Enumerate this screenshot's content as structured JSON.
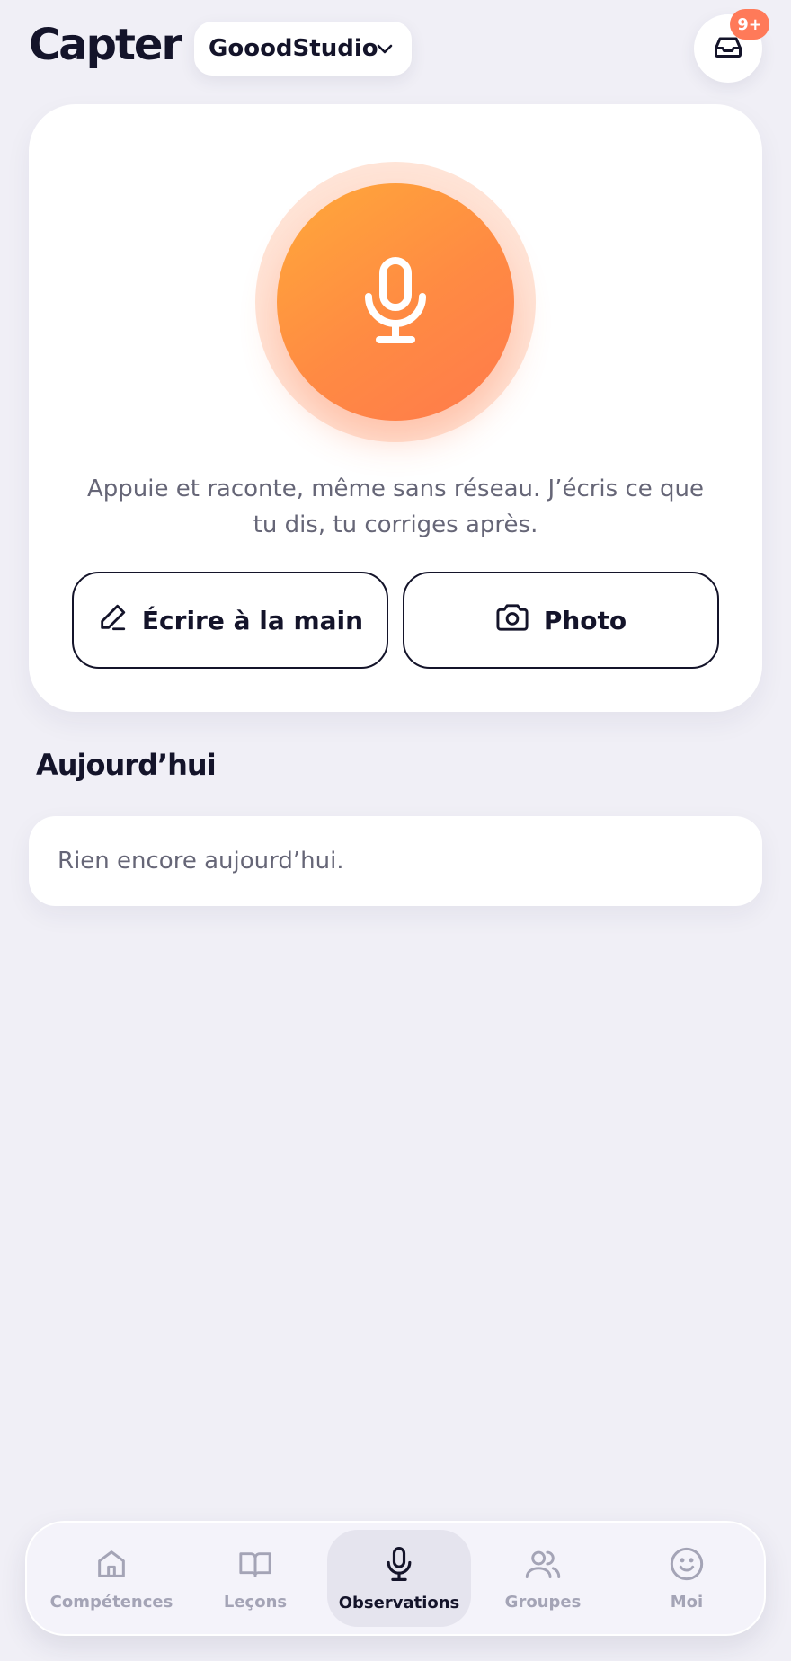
{
  "header": {
    "title": "Capter",
    "studio": "GooodStudio",
    "notification_badge": "9+",
    "icons": {
      "studio_chevron": "chevron-down-icon",
      "inbox": "inbox-icon"
    }
  },
  "capture": {
    "mic_icon": "microphone-icon",
    "hint": "Appuie et raconte, même sans réseau. J’écris ce que tu dis, tu corriges après.",
    "write_label": "Écrire à la main",
    "photo_label": "Photo"
  },
  "today": {
    "title": "Aujourd’hui",
    "empty": "Rien encore aujourd’hui."
  },
  "colors": {
    "accent": "#ff8a43",
    "badge": "#ff7a59",
    "background": "#f0eff6"
  },
  "nav": {
    "items": [
      {
        "label": "Compétences",
        "icon": "home-icon",
        "active": false
      },
      {
        "label": "Leçons",
        "icon": "book-icon",
        "active": false
      },
      {
        "label": "Observations",
        "icon": "microphone-icon",
        "active": true
      },
      {
        "label": "Groupes",
        "icon": "users-icon",
        "active": false
      },
      {
        "label": "Moi",
        "icon": "smiley-icon",
        "active": false
      }
    ]
  }
}
